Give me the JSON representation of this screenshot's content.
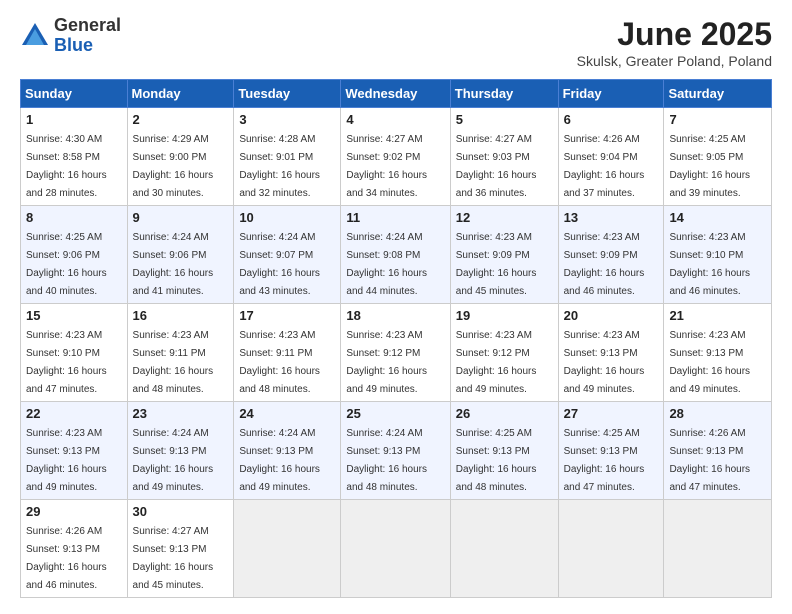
{
  "logo": {
    "general": "General",
    "blue": "Blue"
  },
  "title": "June 2025",
  "location": "Skulsk, Greater Poland, Poland",
  "headers": [
    "Sunday",
    "Monday",
    "Tuesday",
    "Wednesday",
    "Thursday",
    "Friday",
    "Saturday"
  ],
  "days": [
    {
      "num": "1",
      "sunrise": "4:30 AM",
      "sunset": "8:58 PM",
      "daylight": "16 hours and 28 minutes."
    },
    {
      "num": "2",
      "sunrise": "4:29 AM",
      "sunset": "9:00 PM",
      "daylight": "16 hours and 30 minutes."
    },
    {
      "num": "3",
      "sunrise": "4:28 AM",
      "sunset": "9:01 PM",
      "daylight": "16 hours and 32 minutes."
    },
    {
      "num": "4",
      "sunrise": "4:27 AM",
      "sunset": "9:02 PM",
      "daylight": "16 hours and 34 minutes."
    },
    {
      "num": "5",
      "sunrise": "4:27 AM",
      "sunset": "9:03 PM",
      "daylight": "16 hours and 36 minutes."
    },
    {
      "num": "6",
      "sunrise": "4:26 AM",
      "sunset": "9:04 PM",
      "daylight": "16 hours and 37 minutes."
    },
    {
      "num": "7",
      "sunrise": "4:25 AM",
      "sunset": "9:05 PM",
      "daylight": "16 hours and 39 minutes."
    },
    {
      "num": "8",
      "sunrise": "4:25 AM",
      "sunset": "9:06 PM",
      "daylight": "16 hours and 40 minutes."
    },
    {
      "num": "9",
      "sunrise": "4:24 AM",
      "sunset": "9:06 PM",
      "daylight": "16 hours and 41 minutes."
    },
    {
      "num": "10",
      "sunrise": "4:24 AM",
      "sunset": "9:07 PM",
      "daylight": "16 hours and 43 minutes."
    },
    {
      "num": "11",
      "sunrise": "4:24 AM",
      "sunset": "9:08 PM",
      "daylight": "16 hours and 44 minutes."
    },
    {
      "num": "12",
      "sunrise": "4:23 AM",
      "sunset": "9:09 PM",
      "daylight": "16 hours and 45 minutes."
    },
    {
      "num": "13",
      "sunrise": "4:23 AM",
      "sunset": "9:09 PM",
      "daylight": "16 hours and 46 minutes."
    },
    {
      "num": "14",
      "sunrise": "4:23 AM",
      "sunset": "9:10 PM",
      "daylight": "16 hours and 46 minutes."
    },
    {
      "num": "15",
      "sunrise": "4:23 AM",
      "sunset": "9:10 PM",
      "daylight": "16 hours and 47 minutes."
    },
    {
      "num": "16",
      "sunrise": "4:23 AM",
      "sunset": "9:11 PM",
      "daylight": "16 hours and 48 minutes."
    },
    {
      "num": "17",
      "sunrise": "4:23 AM",
      "sunset": "9:11 PM",
      "daylight": "16 hours and 48 minutes."
    },
    {
      "num": "18",
      "sunrise": "4:23 AM",
      "sunset": "9:12 PM",
      "daylight": "16 hours and 49 minutes."
    },
    {
      "num": "19",
      "sunrise": "4:23 AM",
      "sunset": "9:12 PM",
      "daylight": "16 hours and 49 minutes."
    },
    {
      "num": "20",
      "sunrise": "4:23 AM",
      "sunset": "9:13 PM",
      "daylight": "16 hours and 49 minutes."
    },
    {
      "num": "21",
      "sunrise": "4:23 AM",
      "sunset": "9:13 PM",
      "daylight": "16 hours and 49 minutes."
    },
    {
      "num": "22",
      "sunrise": "4:23 AM",
      "sunset": "9:13 PM",
      "daylight": "16 hours and 49 minutes."
    },
    {
      "num": "23",
      "sunrise": "4:24 AM",
      "sunset": "9:13 PM",
      "daylight": "16 hours and 49 minutes."
    },
    {
      "num": "24",
      "sunrise": "4:24 AM",
      "sunset": "9:13 PM",
      "daylight": "16 hours and 49 minutes."
    },
    {
      "num": "25",
      "sunrise": "4:24 AM",
      "sunset": "9:13 PM",
      "daylight": "16 hours and 48 minutes."
    },
    {
      "num": "26",
      "sunrise": "4:25 AM",
      "sunset": "9:13 PM",
      "daylight": "16 hours and 48 minutes."
    },
    {
      "num": "27",
      "sunrise": "4:25 AM",
      "sunset": "9:13 PM",
      "daylight": "16 hours and 47 minutes."
    },
    {
      "num": "28",
      "sunrise": "4:26 AM",
      "sunset": "9:13 PM",
      "daylight": "16 hours and 47 minutes."
    },
    {
      "num": "29",
      "sunrise": "4:26 AM",
      "sunset": "9:13 PM",
      "daylight": "16 hours and 46 minutes."
    },
    {
      "num": "30",
      "sunrise": "4:27 AM",
      "sunset": "9:13 PM",
      "daylight": "16 hours and 45 minutes."
    }
  ],
  "labels": {
    "sunrise": "Sunrise:",
    "sunset": "Sunset:",
    "daylight": "Daylight:"
  }
}
